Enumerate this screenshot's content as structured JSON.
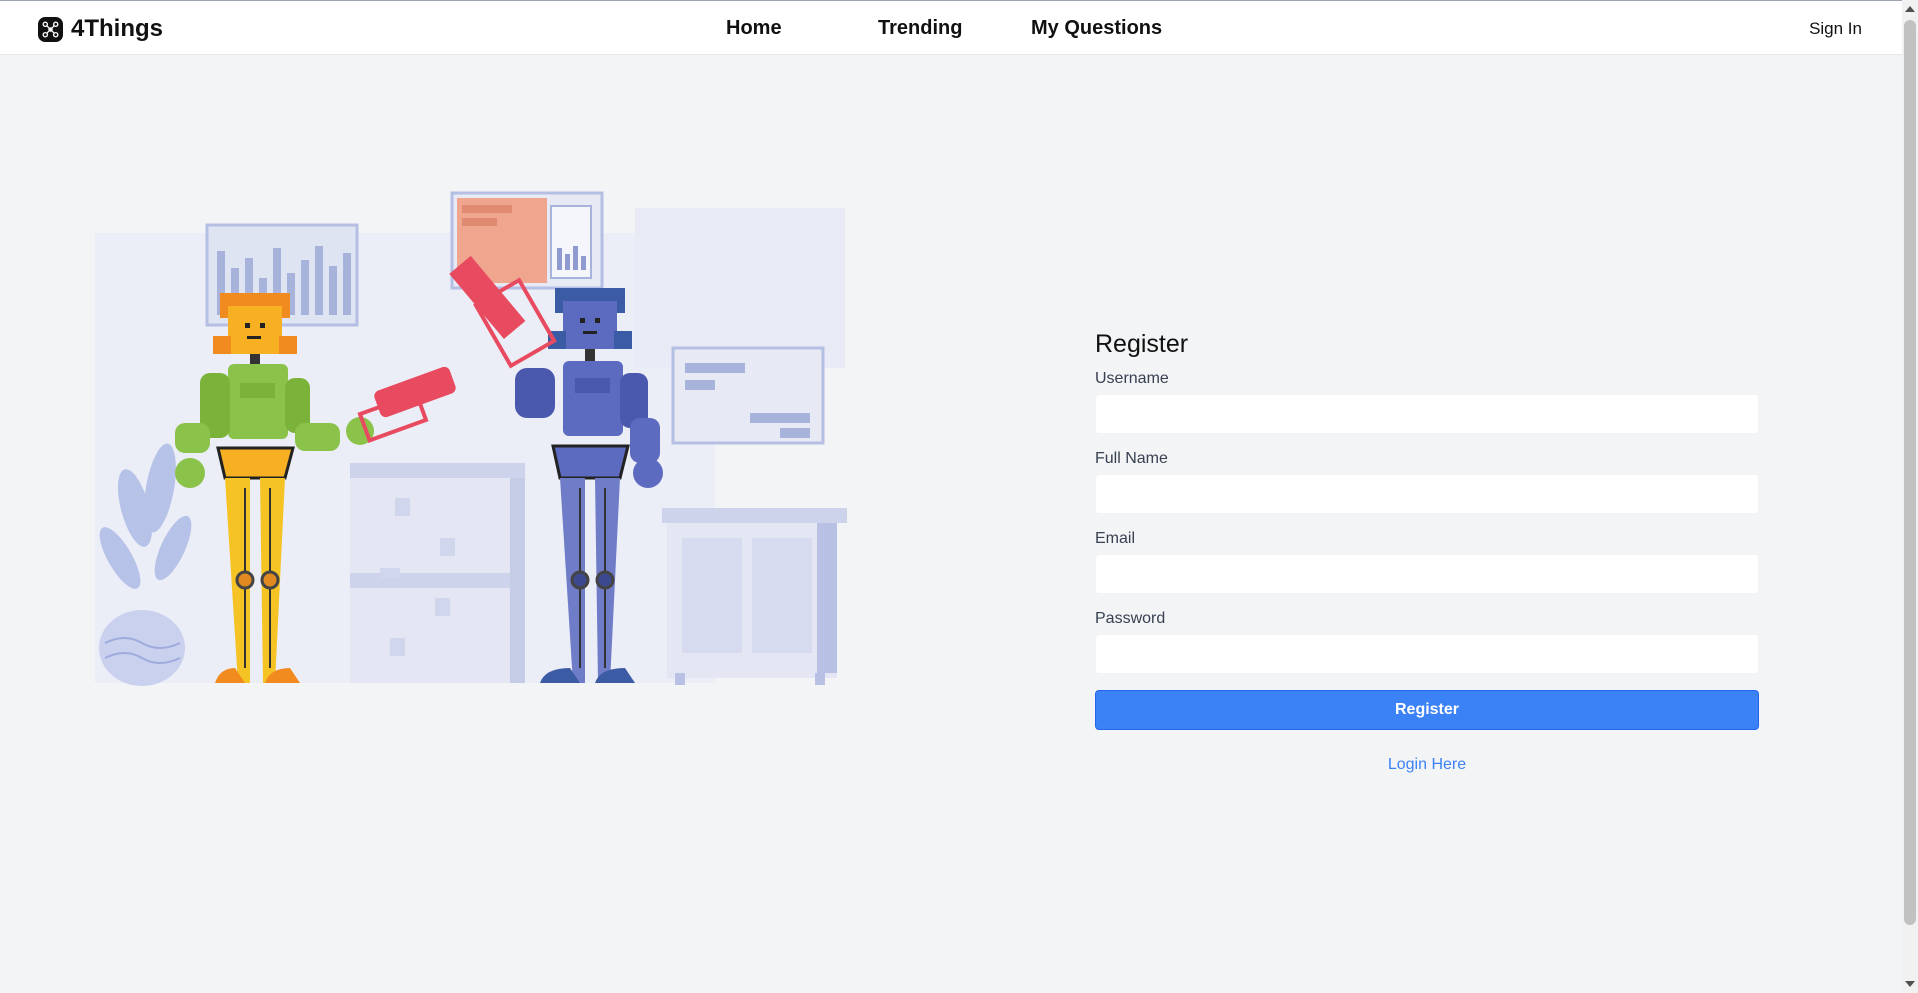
{
  "header": {
    "brand": "4Things",
    "nav": {
      "home": "Home",
      "trending": "Trending",
      "my_questions": "My Questions"
    },
    "sign_in": "Sign In"
  },
  "register": {
    "title": "Register",
    "fields": {
      "username": {
        "label": "Username",
        "value": "",
        "placeholder": ""
      },
      "full_name": {
        "label": "Full Name",
        "value": "",
        "placeholder": ""
      },
      "email": {
        "label": "Email",
        "value": "",
        "placeholder": ""
      },
      "password": {
        "label": "Password",
        "value": "",
        "placeholder": ""
      }
    },
    "submit_label": "Register",
    "login_link": "Login Here"
  },
  "illustration": {
    "icon": "robots-illustration"
  },
  "colors": {
    "accent": "#3b82f6",
    "background": "#f3f4f6",
    "robot_left": "#8bc34a",
    "robot_right": "#5c6bc0",
    "tool": "#e84a5f"
  }
}
